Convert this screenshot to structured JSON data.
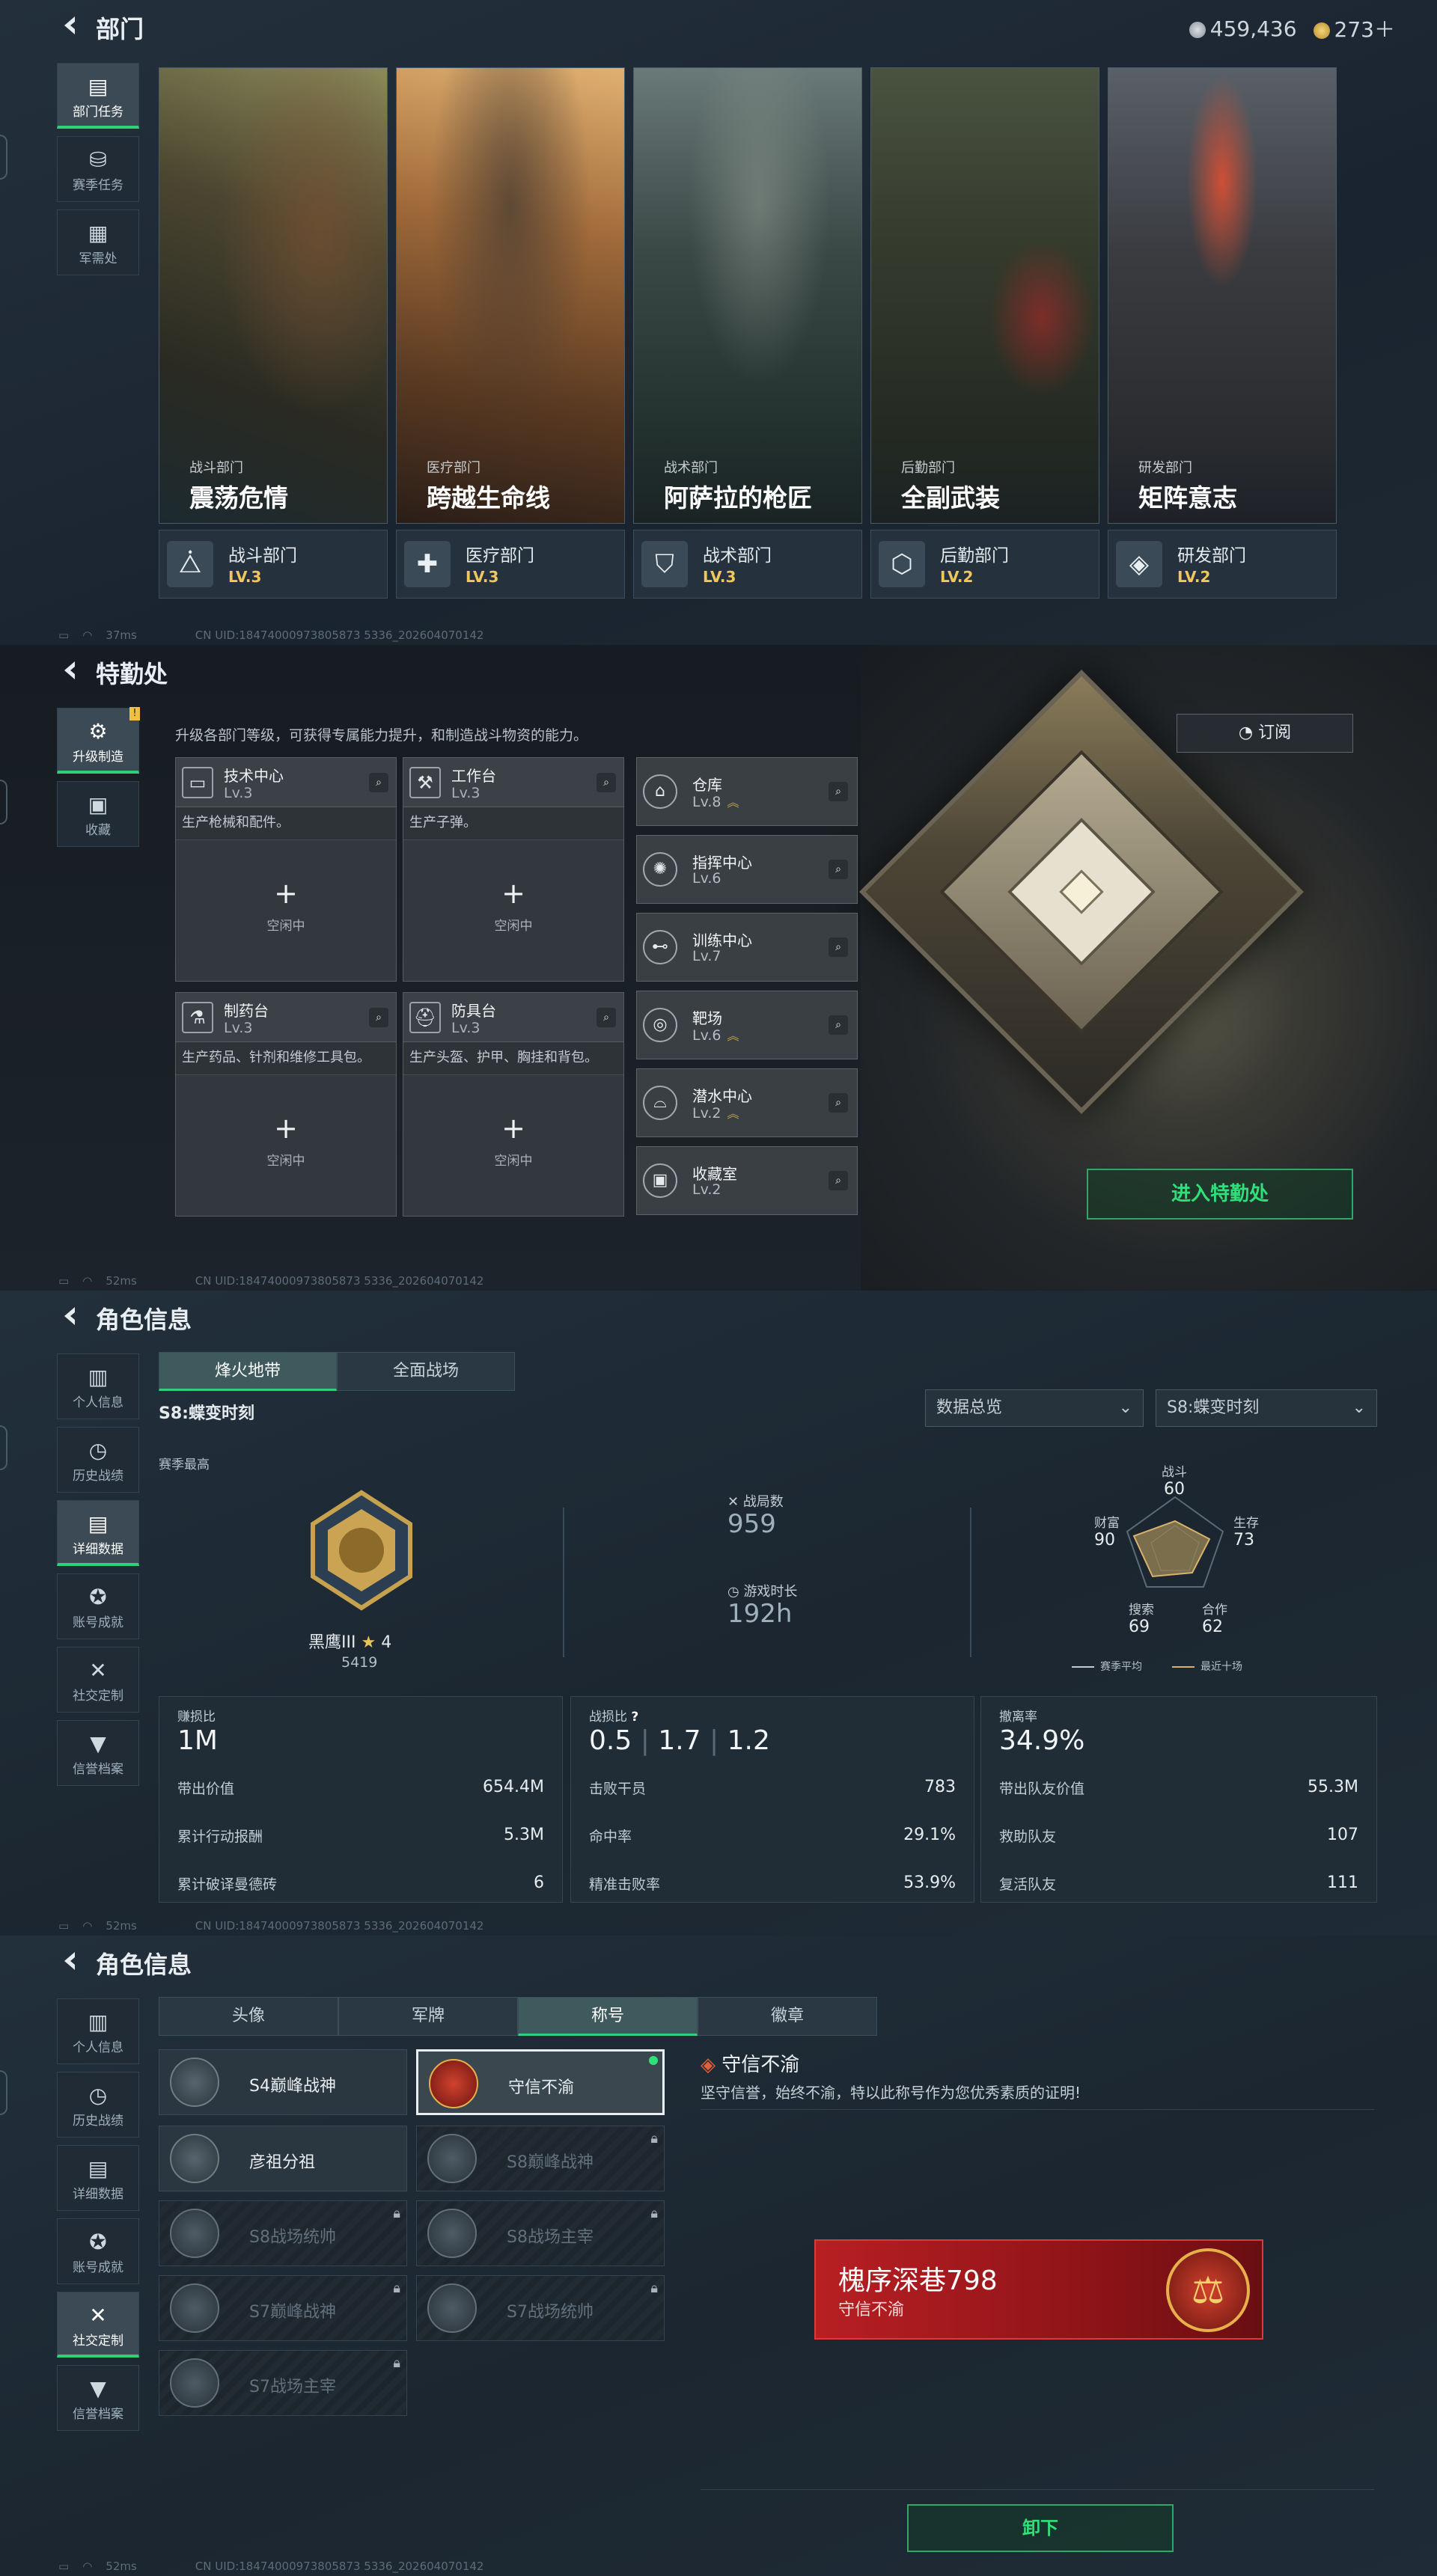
{
  "panel1": {
    "title": "部门",
    "currency": {
      "coins": "459,436",
      "gold": "273＋"
    },
    "nav": [
      "部门任务",
      "赛季任务",
      "军需处"
    ],
    "cards": [
      {
        "sub": "战斗部门",
        "name": "震荡危情"
      },
      {
        "sub": "医疗部门",
        "name": "跨越生命线"
      },
      {
        "sub": "战术部门",
        "name": "阿萨拉的枪匠"
      },
      {
        "sub": "后勤部门",
        "name": "全副武装"
      },
      {
        "sub": "研发部门",
        "name": "矩阵意志"
      }
    ],
    "depts": [
      {
        "name": "战斗部门",
        "lv": "LV.3"
      },
      {
        "name": "医疗部门",
        "lv": "LV.3"
      },
      {
        "name": "战术部门",
        "lv": "LV.3"
      },
      {
        "name": "后勤部门",
        "lv": "LV.2"
      },
      {
        "name": "研发部门",
        "lv": "LV.2"
      }
    ],
    "footer": {
      "ping": "37ms",
      "uid": "CN UID:18474000973805873 5336_202604070142"
    }
  },
  "panel2": {
    "title": "特勤处",
    "nav": [
      "升级制造",
      "收藏"
    ],
    "intro": "升级各部门等级，可获得专属能力提升，和制造战斗物资的能力。",
    "subscribe": "订阅",
    "facilities": [
      {
        "name": "技术中心",
        "lv": "Lv.3",
        "desc": "生产枪械和配件。",
        "idle": "空闲中"
      },
      {
        "name": "工作台",
        "lv": "Lv.3",
        "desc": "生产子弹。",
        "idle": "空闲中"
      },
      {
        "name": "制药台",
        "lv": "Lv.3",
        "desc": "生产药品、针剂和维修工具包。",
        "idle": "空闲中"
      },
      {
        "name": "防具台",
        "lv": "Lv.3",
        "desc": "生产头盔、护甲、胸挂和背包。",
        "idle": "空闲中"
      }
    ],
    "rooms": [
      {
        "name": "仓库",
        "lv": "Lv.8"
      },
      {
        "name": "指挥中心",
        "lv": "Lv.6"
      },
      {
        "name": "训练中心",
        "lv": "Lv.7"
      },
      {
        "name": "靶场",
        "lv": "Lv.6"
      },
      {
        "name": "潜水中心",
        "lv": "Lv.2"
      },
      {
        "name": "收藏室",
        "lv": "Lv.2"
      }
    ],
    "enter": "进入特勤处",
    "footer": {
      "ping": "52ms",
      "uid": "CN UID:18474000973805873 5336_202604070142"
    }
  },
  "panel3": {
    "title": "角色信息",
    "nav": [
      "个人信息",
      "历史战绩",
      "详细数据",
      "账号成就",
      "社交定制",
      "信誉档案"
    ],
    "tabs": [
      "烽火地带",
      "全面战场"
    ],
    "season": "S8:蝶变时刻",
    "selects": [
      "数据总览",
      "S8:蝶变时刻"
    ],
    "season_best": "赛季最高",
    "rank": {
      "name": "黑鹰III",
      "stars": "4",
      "score": "5419"
    },
    "battles_label": "战局数",
    "battles": "959",
    "time_label": "游戏时长",
    "time": "192h",
    "radar": {
      "labels": [
        "战斗",
        "生存",
        "合作",
        "搜索",
        "财富"
      ],
      "values": [
        "60",
        "73",
        "62",
        "69",
        "90"
      ],
      "legend": [
        "赛季平均",
        "最近十场"
      ]
    },
    "card1": {
      "label": "赚损比",
      "big": "1M",
      "rows": [
        [
          "带出价值",
          "654.4M"
        ],
        [
          "累计行动报酬",
          "5.3M"
        ],
        [
          "累计破译曼德砖",
          "6"
        ]
      ]
    },
    "card2": {
      "label": "战损比",
      "q": "?",
      "vals": [
        "0.5",
        "1.7",
        "1.2"
      ],
      "rows": [
        [
          "击败干员",
          "783"
        ],
        [
          "命中率",
          "29.1%"
        ],
        [
          "精准击败率",
          "53.9%"
        ]
      ]
    },
    "card3": {
      "label": "撤离率",
      "big": "34.9%",
      "rows": [
        [
          "带出队友价值",
          "55.3M"
        ],
        [
          "救助队友",
          "107"
        ],
        [
          "复活队友",
          "111"
        ]
      ]
    },
    "footer": {
      "ping": "52ms",
      "uid": "CN UID:18474000973805873 5336_202604070142"
    }
  },
  "panel4": {
    "title": "角色信息",
    "nav": [
      "个人信息",
      "历史战绩",
      "详细数据",
      "账号成就",
      "社交定制",
      "信誉档案"
    ],
    "tabs": [
      "头像",
      "军牌",
      "称号",
      "徽章"
    ],
    "titles": [
      {
        "name": "S4巅峰战神",
        "state": "normal"
      },
      {
        "name": "守信不渝",
        "state": "selected"
      },
      {
        "name": "彦祖分祖",
        "state": "normal"
      },
      {
        "name": "S8巅峰战神",
        "state": "locked"
      },
      {
        "name": "S8战场统帅",
        "state": "locked"
      },
      {
        "name": "S8战场主宰",
        "state": "locked"
      },
      {
        "name": "S7巅峰战神",
        "state": "locked"
      },
      {
        "name": "S7战场统帅",
        "state": "locked"
      },
      {
        "name": "S7战场主宰",
        "state": "locked"
      }
    ],
    "detail_title": "守信不渝",
    "detail_desc": "坚守信誉，始终不渝，特以此称号作为您优秀素质的证明!",
    "banner": {
      "name": "槐序深巷798",
      "sub": "守信不渝"
    },
    "unload": "卸下",
    "footer": {
      "ping": "52ms",
      "uid": "CN UID:18474000973805873 5336_202604070142"
    }
  },
  "colors": {
    "accent_green": "#30d07a",
    "level_gold": "#f0c85a",
    "banner_red": "#b81f23"
  }
}
